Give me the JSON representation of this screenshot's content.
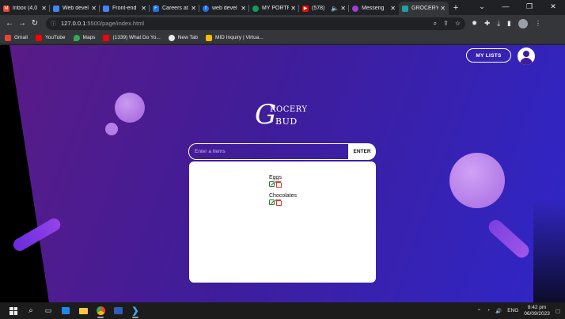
{
  "browser": {
    "tabs": [
      {
        "label": "Inbox (4,0",
        "favicon": "gmail-icon",
        "color": "#ea4335"
      },
      {
        "label": "Web devel",
        "favicon": "web-icon",
        "color": "#4285f4"
      },
      {
        "label": "Front-end",
        "favicon": "web-icon",
        "color": "#4285f4"
      },
      {
        "label": "Careers at",
        "favicon": "f-icon",
        "color": "#1a73e8"
      },
      {
        "label": "web devel",
        "favicon": "facebook-icon",
        "color": "#1877f2"
      },
      {
        "label": "MY PORTF",
        "favicon": "portfolio-icon",
        "color": "#0f9d58"
      },
      {
        "label": "(578)",
        "favicon": "youtube-icon",
        "color": "#ff0000"
      },
      {
        "label": "Messeng",
        "favicon": "messenger-icon",
        "color": "#a33bd6"
      },
      {
        "label": "GROCERY",
        "favicon": "grocery-icon",
        "color": "#20a0a0"
      }
    ],
    "url_host": "127.0.0.1",
    "url_path": ":5500/page/index.html",
    "bookmarks": [
      {
        "label": "Gmail",
        "color": "#ea4335"
      },
      {
        "label": "YouTube",
        "color": "#ff0000"
      },
      {
        "label": "Maps",
        "color": "#34a853"
      },
      {
        "label": "(1339) What Do Yo...",
        "color": "#ff0000"
      },
      {
        "label": "New Tab",
        "color": "#e8eaed"
      },
      {
        "label": "MID Inquiry | Virtua...",
        "color": "#fbbc04"
      }
    ]
  },
  "app": {
    "my_lists_label": "MY LISTS",
    "logo": {
      "letter": "G",
      "top": "ROCERY",
      "bottom": "BUD"
    },
    "input_placeholder": "Enter a Items",
    "enter_label": "ENTER",
    "items": [
      {
        "name": "Eggs"
      },
      {
        "name": "Chocolates"
      }
    ],
    "colors": {
      "gradient_start": "#5a1b86",
      "gradient_end": "#2f26c8"
    }
  },
  "taskbar": {
    "language": "ENG",
    "time": "8:42 pm",
    "date": "06/09/2023"
  }
}
